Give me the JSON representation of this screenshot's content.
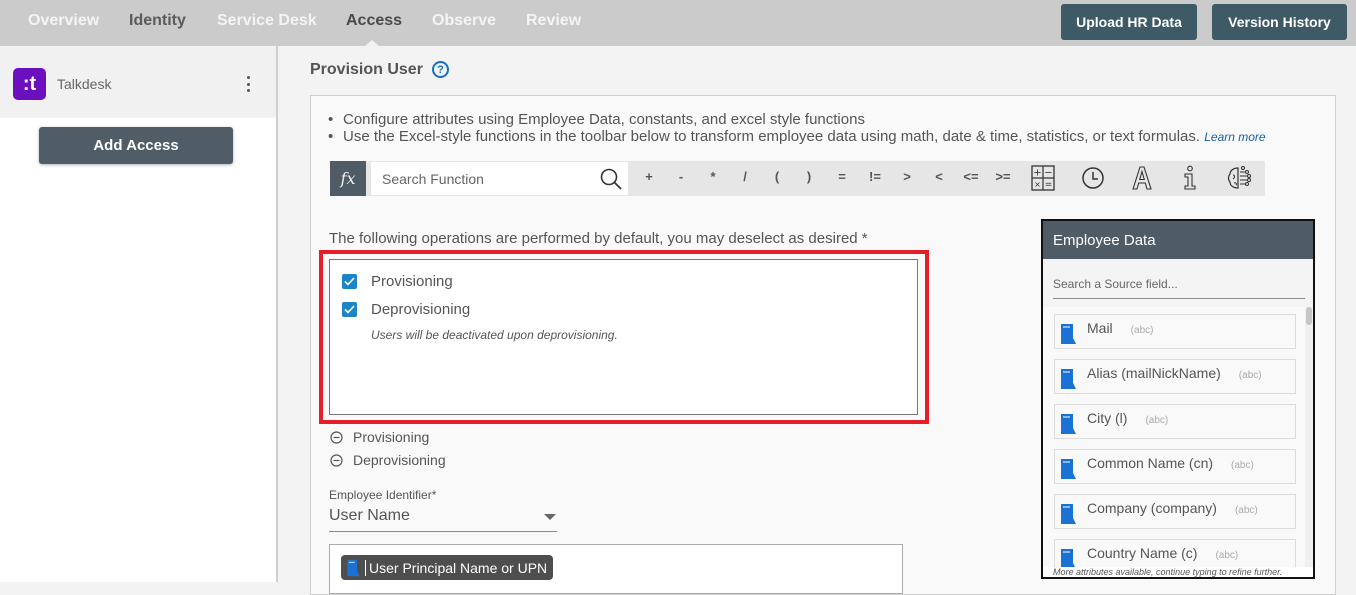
{
  "nav": {
    "tabs": [
      {
        "label": "Overview",
        "state": "default"
      },
      {
        "label": "Identity",
        "state": "dim"
      },
      {
        "label": "Service Desk",
        "state": "default"
      },
      {
        "label": "Access",
        "state": "active"
      },
      {
        "label": "Observe",
        "state": "default"
      },
      {
        "label": "Review",
        "state": "default"
      }
    ],
    "buttons": {
      "upload_hr_data": "Upload HR Data",
      "version_history": "Version History"
    }
  },
  "sidebar": {
    "app": {
      "logo_text": ":t",
      "name": "Talkdesk"
    },
    "add_access_label": "Add Access"
  },
  "main": {
    "title": "Provision User",
    "help_icon": "?",
    "bullets": [
      "Configure attributes using Employee Data, constants, and excel style functions",
      "Use the Excel-style functions in the toolbar below to transform employee data using math, date & time, statistics, or text formulas."
    ],
    "learn_more": "Learn more",
    "toolbar": {
      "fx_label": "fx",
      "search_placeholder": "Search Function",
      "operators": [
        "+",
        "-",
        "*",
        "/",
        "(",
        ")",
        "=",
        "!=",
        ">",
        "<",
        "<=",
        ">="
      ],
      "icons": [
        "calculator-icon",
        "clock-icon",
        "text-icon",
        "info-icon",
        "ai-brain-icon"
      ]
    },
    "operations": {
      "label": "The following operations are performed by default, you may deselect as desired *",
      "items": [
        {
          "label": "Provisioning",
          "checked": true
        },
        {
          "label": "Deprovisioning",
          "checked": true
        }
      ],
      "deprovision_note": "Users will be deactivated upon deprovisioning."
    },
    "sections": [
      {
        "label": "Provisioning",
        "expanded": true
      },
      {
        "label": "Deprovisioning",
        "expanded": true
      }
    ],
    "employee_identifier": {
      "label": "Employee Identifier*",
      "value": "User Name"
    },
    "upn_chip": "User Principal Name or UPN"
  },
  "employee_data": {
    "title": "Employee Data",
    "search_placeholder": "Search a Source field...",
    "items": [
      {
        "name": "Mail",
        "type": "(abc)"
      },
      {
        "name": "Alias (mailNickName)",
        "type": "(abc)"
      },
      {
        "name": "City (l)",
        "type": "(abc)"
      },
      {
        "name": "Common Name (cn)",
        "type": "(abc)"
      },
      {
        "name": "Company (company)",
        "type": "(abc)"
      },
      {
        "name": "Country Name (c)",
        "type": "(abc)"
      }
    ],
    "footer": "More attributes available, continue typing to refine further."
  },
  "colors": {
    "nav_bg": "#cbcbcb",
    "top_button": "#3d5a66",
    "dark_slate": "#4f5b65",
    "highlight_red": "#e41f2a",
    "checkbox_blue": "#1a86c8",
    "link_blue": "#1a5ea8",
    "talkdesk_purple": "#6b0fbf"
  }
}
